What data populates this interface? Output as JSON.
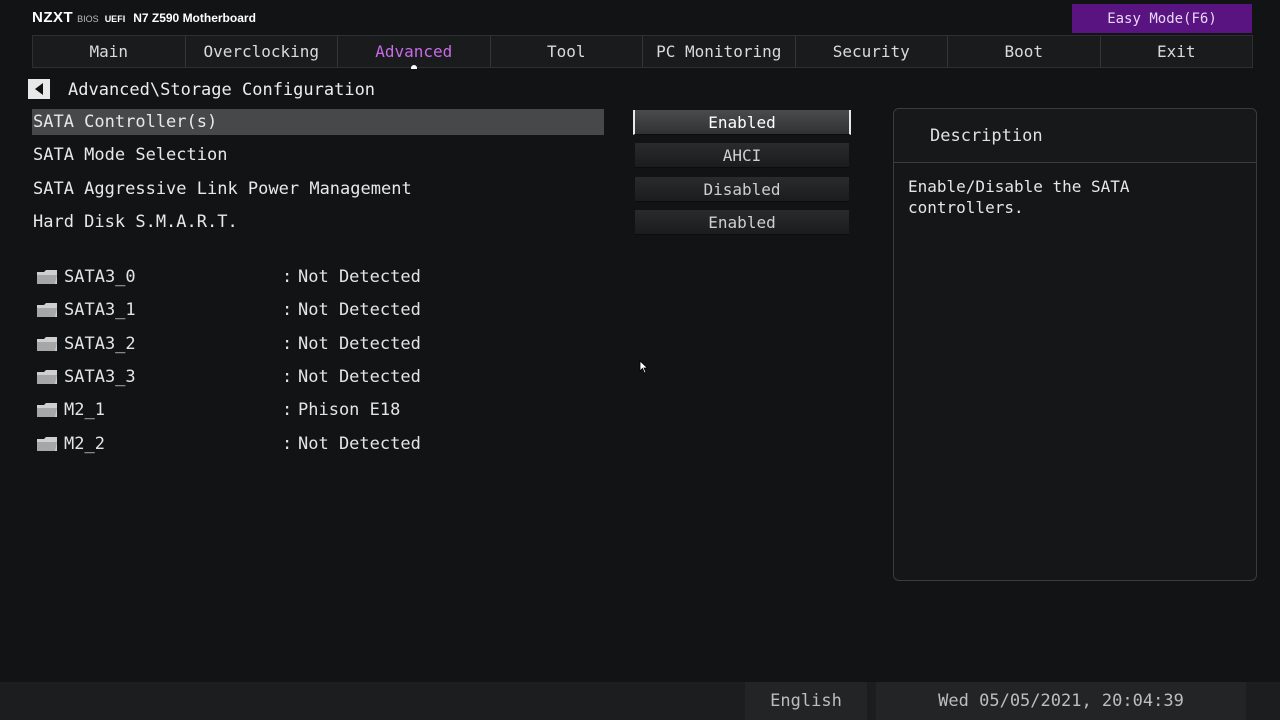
{
  "brand": {
    "logo": "NZXT",
    "bios": "BIOS",
    "uefi": "UEFI",
    "model": "N7 Z590 Motherboard"
  },
  "easy_mode_label": "Easy Mode(F6)",
  "tabs": [
    {
      "label": "Main"
    },
    {
      "label": "Overclocking"
    },
    {
      "label": "Advanced"
    },
    {
      "label": "Tool"
    },
    {
      "label": "PC Monitoring"
    },
    {
      "label": "Security"
    },
    {
      "label": "Boot"
    },
    {
      "label": "Exit"
    }
  ],
  "active_tab": "Advanced",
  "breadcrumb": "Advanced\\Storage Configuration",
  "settings": [
    {
      "label": "SATA Controller(s)",
      "value": "Enabled"
    },
    {
      "label": "SATA Mode Selection",
      "value": "AHCI"
    },
    {
      "label": "SATA Aggressive Link Power Management",
      "value": "Disabled"
    },
    {
      "label": "Hard Disk S.M.A.R.T.",
      "value": "Enabled"
    }
  ],
  "drives": [
    {
      "name": "SATA3_0",
      "colon": ":",
      "status": "Not Detected"
    },
    {
      "name": "SATA3_1",
      "colon": ":",
      "status": "Not Detected"
    },
    {
      "name": "SATA3_2",
      "colon": ":",
      "status": "Not Detected"
    },
    {
      "name": "SATA3_3",
      "colon": ":",
      "status": "Not Detected"
    },
    {
      "name": "M2_1",
      "colon": ":",
      "status": "Phison E18"
    },
    {
      "name": "M2_2",
      "colon": ":",
      "status": "Not Detected"
    }
  ],
  "description": {
    "title": "Description",
    "text": "Enable/Disable the SATA controllers."
  },
  "footer": {
    "language": "English",
    "datetime": "Wed 05/05/2021, 20:04:39"
  },
  "colors": {
    "accent": "#c76be8",
    "easy_mode_bg": "#5a1482",
    "background": "#121314"
  },
  "icons": [
    "back-arrow-icon",
    "folder-icon",
    "mouse-cursor-icon"
  ]
}
